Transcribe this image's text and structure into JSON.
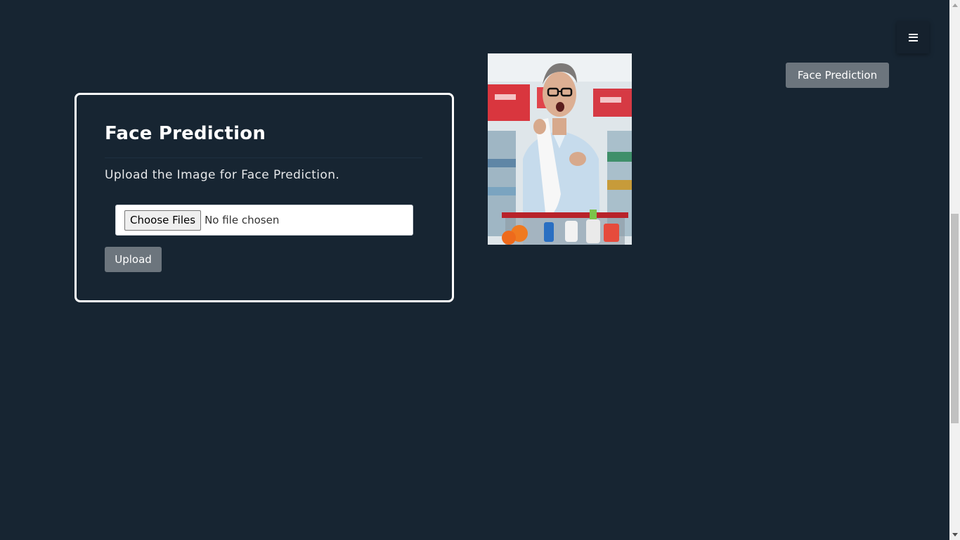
{
  "header": {
    "menu_icon": "hamburger-menu-icon",
    "nav_button_label": "Face Prediction"
  },
  "card": {
    "title": "Face Prediction",
    "description": "Upload the Image for Face Prediction.",
    "file_input": {
      "button_label": "Choose Files",
      "status_text": "No file chosen"
    },
    "upload_label": "Upload"
  },
  "photo": {
    "subject": "man-reading-receipt-photo"
  },
  "colors": {
    "background": "#172532",
    "button_gray": "#6c757d",
    "card_border": "#ffffff"
  }
}
